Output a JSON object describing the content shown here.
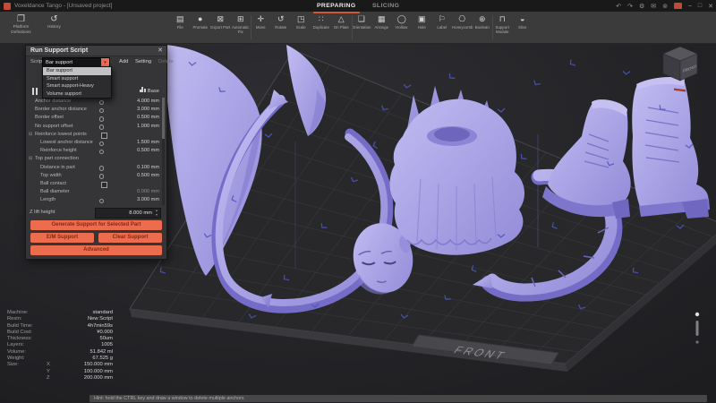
{
  "window": {
    "title": "Voxeldance Tango - [Unsaved project]",
    "tabs": [
      {
        "label": "PREPARING"
      },
      {
        "label": "SLICING"
      }
    ],
    "controls": {
      "undo": "↶",
      "redo": "↷",
      "settings": "⚙",
      "feedback": "✉",
      "account": "⊚",
      "minimize": "–",
      "maximize": "□",
      "close": "✕"
    }
  },
  "toolbar": {
    "left": [
      {
        "dn": "toolbar-button-platform-definitions",
        "glyph": "❐",
        "label": "Platform Definitions"
      },
      {
        "dn": "toolbar-button-history",
        "glyph": "↺",
        "label": "History"
      }
    ],
    "items": [
      {
        "dn": "toolbar-button-file",
        "glyph": "▤",
        "label": "File"
      },
      {
        "dn": "toolbar-button-promate",
        "glyph": "●",
        "label": "Promate"
      },
      {
        "dn": "toolbar-button-export-part",
        "glyph": "⊠",
        "label": "Export Part"
      },
      {
        "dn": "toolbar-button-automatic-fix",
        "glyph": "⊞",
        "label": "Automatic Fix"
      },
      {
        "dn": "toolbar-button-move",
        "glyph": "✛",
        "label": "Move"
      },
      {
        "dn": "toolbar-button-rotate",
        "glyph": "↺",
        "label": "Rotate"
      },
      {
        "dn": "toolbar-button-scale",
        "glyph": "◳",
        "label": "Scale"
      },
      {
        "dn": "toolbar-button-duplicate",
        "glyph": "∷",
        "label": "Duplicate"
      },
      {
        "dn": "toolbar-button-on-plate",
        "glyph": "△",
        "label": "On Plate"
      },
      {
        "dn": "toolbar-button-orientation",
        "glyph": "❏",
        "label": "Orientation"
      },
      {
        "dn": "toolbar-button-arrange",
        "glyph": "▦",
        "label": "Arrange"
      },
      {
        "dn": "toolbar-button-hollow",
        "glyph": "◯",
        "label": "Hollow"
      },
      {
        "dn": "toolbar-button-hole",
        "glyph": "▣",
        "label": "Hole"
      },
      {
        "dn": "toolbar-button-label",
        "glyph": "⚐",
        "label": "Label"
      },
      {
        "dn": "toolbar-button-honeycomb",
        "glyph": "⎔",
        "label": "Honeycomb"
      },
      {
        "dn": "toolbar-button-boolean",
        "glyph": "⊕",
        "label": "Boolean"
      },
      {
        "dn": "toolbar-button-support-module",
        "glyph": "⊓",
        "label": "Support Module"
      },
      {
        "dn": "toolbar-button-slice",
        "glyph": "◒",
        "label": "Slice"
      }
    ]
  },
  "support_panel": {
    "title": "Run Support Script",
    "close": "✕",
    "script_label": "Script",
    "script_value": "Bar support",
    "select_arrow": "▾",
    "action_add": "Add",
    "action_setting": "Setting",
    "action_delete": "Delete",
    "dropdown": [
      {
        "label": "Bar support",
        "cls": "sel"
      },
      {
        "label": "Smart support"
      },
      {
        "label": "Smart support-Heavy"
      },
      {
        "label": "Volume support"
      }
    ],
    "base_label": "Base",
    "settings": [
      {
        "label": "Anchor distance",
        "value": "4.000 mm",
        "cls": "val",
        "prefix": ""
      },
      {
        "label": "Border anchor distance",
        "value": "3.000 mm",
        "cls": "val",
        "prefix": ""
      },
      {
        "label": "Border offset",
        "value": "0.500 mm",
        "cls": "val",
        "prefix": ""
      },
      {
        "label": "No support offset",
        "value": "1.000 mm",
        "cls": "val",
        "prefix": ""
      },
      {
        "label": "Reinforce lowest points",
        "value": "",
        "cls": "chk",
        "prefix": "⊟"
      },
      {
        "label": "Lowest anchor distance",
        "value": "1.500 mm",
        "cls": "val ind1",
        "prefix": ""
      },
      {
        "label": "Reinforce height",
        "value": "0.500 mm",
        "cls": "val ind1",
        "prefix": ""
      },
      {
        "label": "Top part connection",
        "value": "",
        "cls": "grp",
        "prefix": "⊟"
      },
      {
        "label": "Distance in part",
        "value": "0.100 mm",
        "cls": "val ind1",
        "prefix": ""
      },
      {
        "label": "Top width",
        "value": "0.500 mm",
        "cls": "val ind1",
        "prefix": ""
      },
      {
        "label": "Ball contact",
        "value": "",
        "cls": "chk ind1",
        "prefix": ""
      },
      {
        "label": "Ball diameter",
        "value": "0.000 mm",
        "cls": "val ind1 nodot dim",
        "prefix": ""
      },
      {
        "label": "Length",
        "value": "3.000 mm",
        "cls": "val ind1",
        "prefix": ""
      }
    ],
    "z_lift": {
      "label": "Z lift height",
      "value": "8.000 mm"
    },
    "buttons": {
      "generate": "Generate Support for Selected Part",
      "em": "E/M Support",
      "clear": "Clear Support",
      "advanced": "Advanced"
    }
  },
  "stats": {
    "rows": [
      {
        "label": "Machine:",
        "value": "standard"
      },
      {
        "label": "Resin:",
        "value": "New Script"
      },
      {
        "label": "Build Time:",
        "value": "4h7min59s"
      },
      {
        "label": "Build Cost:",
        "value": "¥0.000"
      },
      {
        "label": "Thickness:",
        "value": "50um"
      },
      {
        "label": "Layers:",
        "value": "1005"
      },
      {
        "label": "Volume:",
        "value": "51.842 ml"
      },
      {
        "label": "Weight:",
        "value": "67.525 g"
      }
    ],
    "size_label": "Size:",
    "size": [
      {
        "axis": "X",
        "value": "150.000 mm"
      },
      {
        "axis": "Y",
        "value": "100.000 mm"
      },
      {
        "axis": "Z",
        "value": "200.000 mm"
      }
    ]
  },
  "hint": "Hint: hold the CTRL key and draw a window to delete multiple anchors",
  "viewport": {
    "front_label": "FRONT",
    "cube_front": "FRONT"
  },
  "colors": {
    "accent_orange": "#ee6c4e",
    "tab_underline": "#cf5634",
    "model_lavender": "#aba3e6",
    "anchor_blue": "#4d55c0",
    "toolbar_bg": "#3b3b3b",
    "panel_bg": "#353537"
  }
}
